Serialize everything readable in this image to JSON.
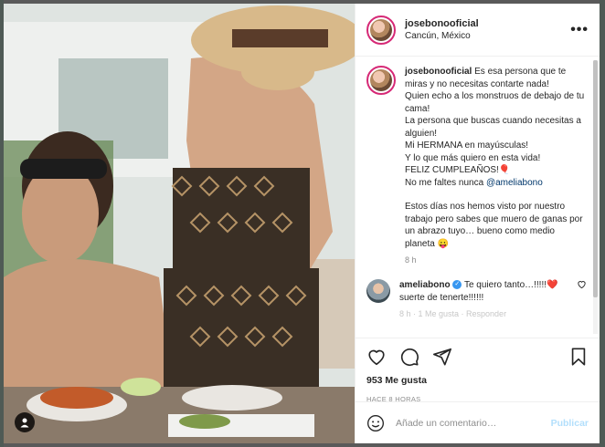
{
  "post": {
    "username": "josebonooficial",
    "location": "Cancún, México",
    "caption": {
      "username": "josebonooficial",
      "lines": [
        "Es esa persona que te miras y no necesitas contarte nada!",
        "Quien echo a los monstruos de debajo de tu cama!",
        "La persona que buscas cuando necesitas a alguien!",
        "Mi HERMANA en mayúsculas!",
        "Y lo que más quiero en esta vida!",
        "FELIZ CUMPLEAÑOS!🎈",
        "No me faltes nunca "
      ],
      "mention": "@ameliabono",
      "paragraph2": "Estos días nos hemos visto por nuestro trabajo pero sabes que muero de ganas por un abrazo tuyo… bueno como medio planeta 😛",
      "time": "8 h"
    },
    "reply": {
      "username": "ameliabono",
      "verified_mark": "✓",
      "text": "Te quiero tanto…!!!!!❤️suerte de tenerte!!!!!!",
      "partial": "8 h · 1 Me gusta · Responder"
    },
    "likes": "953 Me gusta",
    "posted_ago": "HACE 8 HORAS",
    "comment_placeholder": "Añade un comentario…",
    "post_button": "Publicar",
    "more_label": "•••",
    "user_tag_icon": "person-icon"
  },
  "colors": {
    "accent": "#0095f6",
    "post_disabled": "#b2dffc",
    "story_ring": "#d62976"
  }
}
